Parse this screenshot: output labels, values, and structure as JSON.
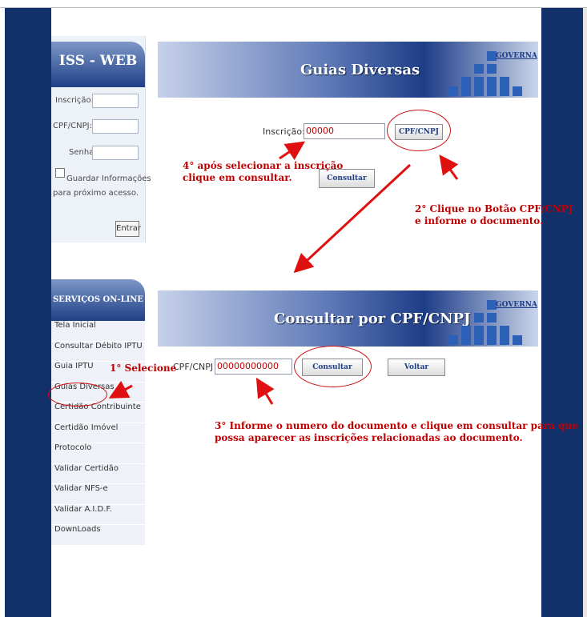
{
  "login": {
    "title": "ISS - WEB",
    "inscricao_label": "Inscrição:",
    "cpf_label": "CPF/CNPJ:",
    "senha_label": "Senha:",
    "remember_line1": "Guardar Informações",
    "remember_line2": "para próximo acesso.",
    "enter_button": "Entrar"
  },
  "services": {
    "title": "SERVIÇOS ON-LINE",
    "items": [
      "Tela Inicial",
      "Consultar Débito IPTU",
      "Guia IPTU",
      "Guias Diversas",
      "Certidão Contribuinte",
      "Certidão Imóvel",
      "Protocolo",
      "Validar Certidão",
      "Validar NFS-e",
      "Validar A.I.D.F.",
      "DownLoads"
    ]
  },
  "banner1": {
    "title": "Guias Diversas",
    "brand": "GOVERNA"
  },
  "banner2": {
    "title": "Consultar por CPF/CNPJ",
    "brand": "GOVERNA"
  },
  "form1": {
    "inscricao_label": "Inscrição:",
    "inscricao_value": "00000",
    "cpf_button": "CPF/CNPJ",
    "consultar_button": "Consultar"
  },
  "form2": {
    "cpf_label": "CPF/CNPJ",
    "cpf_value": "00000000000",
    "consultar_button": "Consultar",
    "voltar_button": "Voltar"
  },
  "annotations": {
    "step1": "1° Selecione",
    "step2_line1": "2° Clique no Botão CPF/CNPJ",
    "step2_line2": "e informe o documento.",
    "step3_line1": "3° Informe o numero do documento e clique em consultar para que",
    "step3_line2": "possa aparecer as inscrições relacionadas ao documento.",
    "step4_line1": "4° após selecionar a inscrição",
    "step4_line2": "clique em consultar."
  },
  "colors": {
    "navy": "#12306a",
    "accent": "#c00000",
    "panel": "#edf1f8"
  }
}
